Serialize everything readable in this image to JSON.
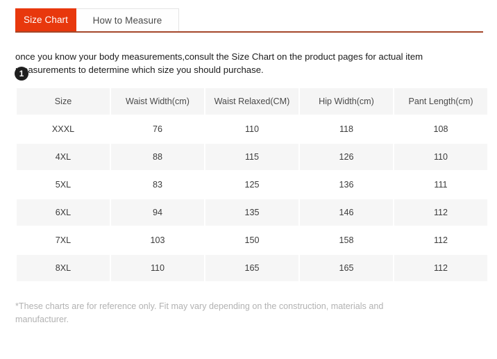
{
  "tabs": [
    {
      "label": "Size Chart",
      "active": true
    },
    {
      "label": "How to Measure",
      "active": false
    }
  ],
  "intro": {
    "text": "once you know your body measurements,consult the Size Chart on the product pages for actual item measurements to determine which size you should purchase."
  },
  "badge": {
    "number": "1"
  },
  "colors": {
    "accent": "#e8380d",
    "underline": "#a4472a",
    "header_bg": "#f5f5f5",
    "stripe_bg": "#f6f6f6",
    "badge_bg": "#1f1f1f",
    "footnote": "#b2b2b2"
  },
  "chart_data": {
    "type": "table",
    "title": "Size Chart",
    "columns": [
      "Size",
      "Waist Width(cm)",
      "Waist Relaxed(CM)",
      "Hip Width(cm)",
      "Pant Length(cm)"
    ],
    "rows": [
      [
        "XXXL",
        "76",
        "110",
        "118",
        "108"
      ],
      [
        "4XL",
        "88",
        "115",
        "126",
        "110"
      ],
      [
        "5XL",
        "83",
        "125",
        "136",
        "111"
      ],
      [
        "6XL",
        "94",
        "135",
        "146",
        "112"
      ],
      [
        "7XL",
        "103",
        "150",
        "158",
        "112"
      ],
      [
        "8XL",
        "110",
        "165",
        "165",
        "112"
      ]
    ]
  },
  "footnote": {
    "text": "*These charts are for reference only. Fit may vary depending on the construction, materials and manufacturer."
  }
}
